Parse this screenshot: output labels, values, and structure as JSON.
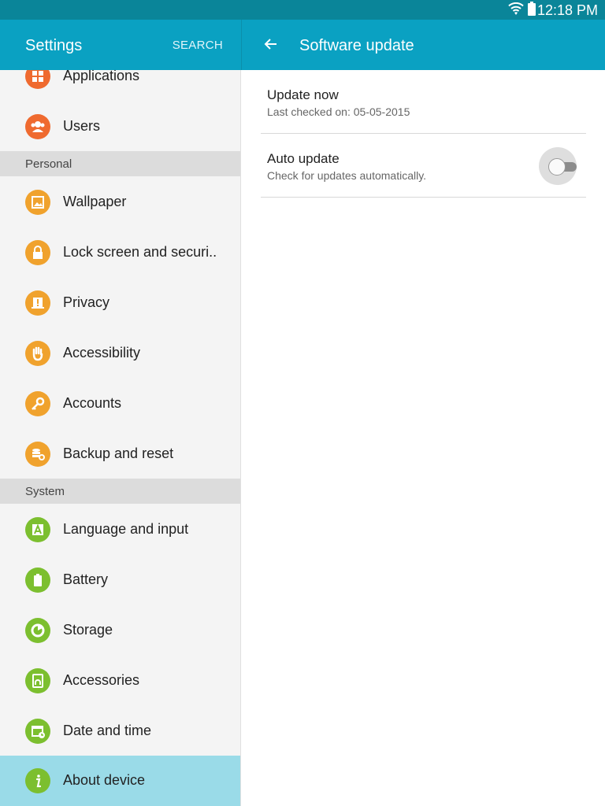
{
  "status_bar": {
    "time": "12:18 PM",
    "wifi_icon": "wifi-icon",
    "battery_icon": "battery-icon"
  },
  "left_header": {
    "title": "Settings",
    "search_label": "SEARCH"
  },
  "right_header": {
    "back_icon": "back-arrow-icon",
    "title": "Software update"
  },
  "sidebar": {
    "items": [
      {
        "label": "Applications",
        "icon": "grid-icon"
      },
      {
        "label": "Users",
        "icon": "users-icon"
      },
      {
        "label": "Wallpaper",
        "icon": "image-icon"
      },
      {
        "label": "Lock screen and securi..",
        "icon": "lock-icon"
      },
      {
        "label": "Privacy",
        "icon": "privacy-icon"
      },
      {
        "label": "Accessibility",
        "icon": "hand-icon"
      },
      {
        "label": "Accounts",
        "icon": "key-icon"
      },
      {
        "label": "Backup and reset",
        "icon": "backup-icon"
      },
      {
        "label": "Language and input",
        "icon": "language-icon"
      },
      {
        "label": "Battery",
        "icon": "battery-icon"
      },
      {
        "label": "Storage",
        "icon": "storage-icon"
      },
      {
        "label": "Accessories",
        "icon": "accessories-icon"
      },
      {
        "label": "Date and time",
        "icon": "calendar-icon"
      },
      {
        "label": "About device",
        "icon": "info-icon",
        "selected": true
      }
    ],
    "sections": {
      "personal": "Personal",
      "system": "System"
    }
  },
  "content": {
    "update_now": {
      "title": "Update now",
      "subtitle": "Last checked on: 05-05-2015"
    },
    "auto_update": {
      "title": "Auto update",
      "subtitle": "Check for updates automatically.",
      "enabled": false
    }
  },
  "colors": {
    "header": "#0aa1c2",
    "statusbar": "#0a8599",
    "selected": "#9adbe8",
    "orange": "#f0a22d",
    "green": "#7cbf2f"
  }
}
